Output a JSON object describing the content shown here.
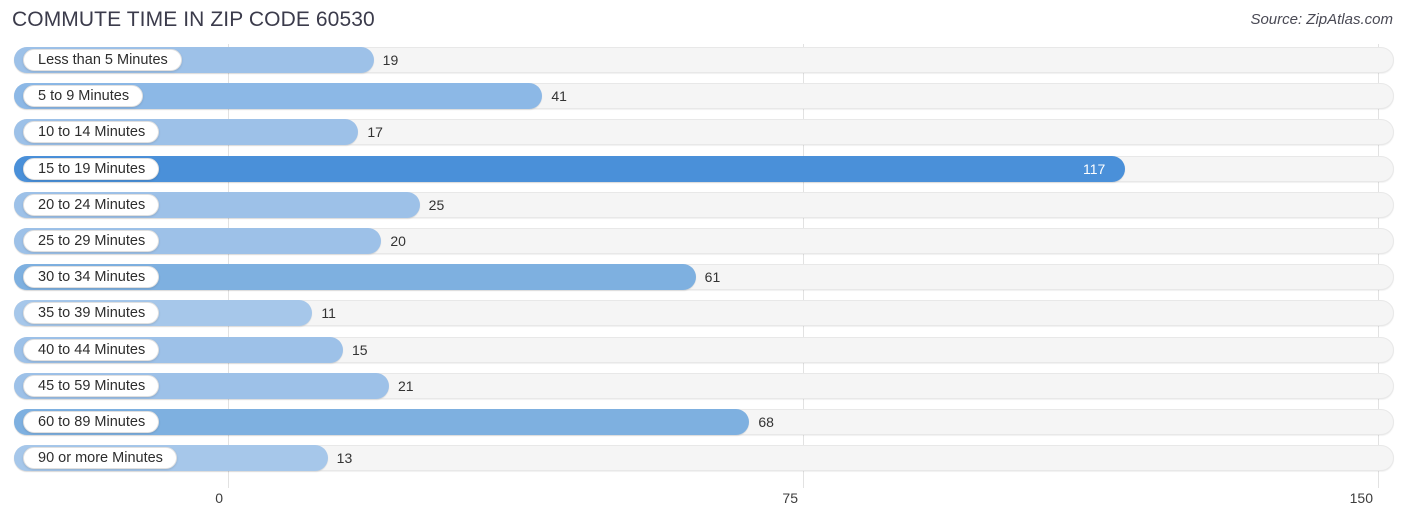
{
  "header": {
    "title": "COMMUTE TIME IN ZIP CODE 60530",
    "source": "Source: ZipAtlas.com"
  },
  "chart_data": {
    "type": "bar",
    "orientation": "horizontal",
    "title": "COMMUTE TIME IN ZIP CODE 60530",
    "subtitle": "",
    "xlabel": "",
    "ylabel": "",
    "xlim": [
      0,
      150
    ],
    "ticks": [
      "0",
      "75",
      "150"
    ],
    "tick_values": [
      0,
      75,
      150
    ],
    "grid": true,
    "legend": "none",
    "categories": [
      "Less than 5 Minutes",
      "5 to 9 Minutes",
      "10 to 14 Minutes",
      "15 to 19 Minutes",
      "20 to 24 Minutes",
      "25 to 29 Minutes",
      "30 to 34 Minutes",
      "35 to 39 Minutes",
      "40 to 44 Minutes",
      "45 to 59 Minutes",
      "60 to 89 Minutes",
      "90 or more Minutes"
    ],
    "values": [
      19,
      41,
      17,
      117,
      25,
      20,
      61,
      11,
      15,
      21,
      68,
      13
    ],
    "value_labels": [
      "19",
      "41",
      "17",
      "117",
      "25",
      "20",
      "61",
      "11",
      "15",
      "21",
      "68",
      "13"
    ],
    "bar_colors": [
      "#9dc1e8",
      "#8cb8e6",
      "#9dc1e8",
      "#4a90d9",
      "#9dc1e8",
      "#9dc1e8",
      "#7eb0e0",
      "#a6c7ea",
      "#9dc1e8",
      "#9dc1e8",
      "#7eb0e0",
      "#a6c7ea"
    ],
    "label_inside": [
      false,
      false,
      false,
      true,
      false,
      false,
      false,
      false,
      false,
      false,
      false,
      false
    ]
  },
  "colors": {
    "track": "#f5f5f5",
    "grid": "#e2e2e2",
    "highlight": "#4a90d9",
    "bar_default": "#9dc1e8",
    "title_text": "#3b3b4b"
  }
}
